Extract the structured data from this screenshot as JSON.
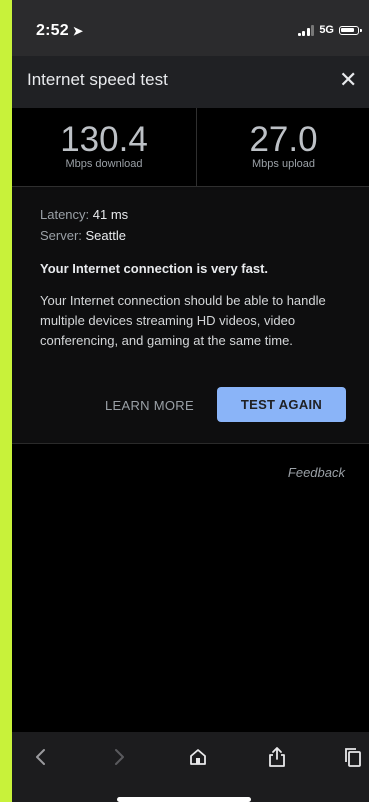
{
  "status_bar": {
    "time": "2:52",
    "network": "5G"
  },
  "header": {
    "title": "Internet speed test",
    "close_label": "✕"
  },
  "results": {
    "download_value": "130.4",
    "download_unit": "Mbps download",
    "upload_value": "27.0",
    "upload_unit": "Mbps upload"
  },
  "details": {
    "latency_label": "Latency: ",
    "latency_value": "41 ms",
    "server_label": "Server: ",
    "server_value": "Seattle",
    "verdict": "Your Internet connection is very fast.",
    "description": "Your Internet connection should be able to handle multiple devices streaming HD videos, video conferencing, and gaming at the same time.",
    "learn_more_label": "LEARN MORE",
    "test_again_label": "TEST AGAIN"
  },
  "feedback_label": "Feedback",
  "toolbar": {
    "icons": [
      "back-icon",
      "forward-icon",
      "home-icon",
      "share-icon",
      "tabs-icon"
    ]
  },
  "colors": {
    "accent": "#8ab4f8",
    "background": "#000000",
    "border_lime": "#c8f23a"
  }
}
